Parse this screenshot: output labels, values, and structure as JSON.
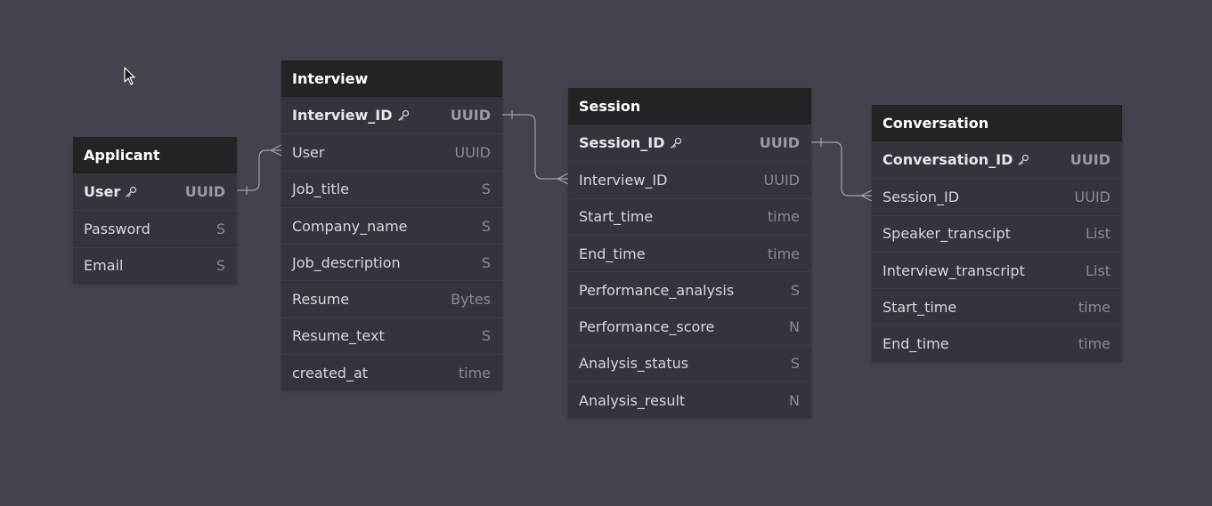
{
  "entities": [
    {
      "title": "Applicant",
      "fields": [
        {
          "name": "User",
          "type": "UUID",
          "pk": true
        },
        {
          "name": "Password",
          "type": "S"
        },
        {
          "name": "Email",
          "type": "S"
        }
      ]
    },
    {
      "title": "Interview",
      "fields": [
        {
          "name": "Interview_ID",
          "type": "UUID",
          "pk": true
        },
        {
          "name": "User",
          "type": "UUID"
        },
        {
          "name": "Job_title",
          "type": "S"
        },
        {
          "name": "Company_name",
          "type": "S"
        },
        {
          "name": "Job_description",
          "type": "S"
        },
        {
          "name": "Resume",
          "type": "Bytes"
        },
        {
          "name": "Resume_text",
          "type": "S"
        },
        {
          "name": "created_at",
          "type": "time"
        }
      ]
    },
    {
      "title": "Session",
      "fields": [
        {
          "name": "Session_ID",
          "type": "UUID",
          "pk": true
        },
        {
          "name": "Interview_ID",
          "type": "UUID"
        },
        {
          "name": "Start_time",
          "type": "time"
        },
        {
          "name": "End_time",
          "type": "time"
        },
        {
          "name": "Performance_analysis",
          "type": "S"
        },
        {
          "name": "Performance_score",
          "type": "N"
        },
        {
          "name": "Analysis_status",
          "type": "S"
        },
        {
          "name": "Analysis_result",
          "type": "N"
        }
      ]
    },
    {
      "title": "Conversation",
      "fields": [
        {
          "name": "Conversation_ID",
          "type": "UUID",
          "pk": true
        },
        {
          "name": "Session_ID",
          "type": "UUID"
        },
        {
          "name": "Speaker_transcipt",
          "type": "List"
        },
        {
          "name": "Interview_transcript",
          "type": "List"
        },
        {
          "name": "Start_time",
          "type": "time"
        },
        {
          "name": "End_time",
          "type": "time"
        }
      ]
    }
  ],
  "relationships": [
    {
      "from": "Applicant.User",
      "to": "Interview.User",
      "cardinality": "one-to-many"
    },
    {
      "from": "Interview.Interview_ID",
      "to": "Session.Interview_ID",
      "cardinality": "one-to-many"
    },
    {
      "from": "Session.Session_ID",
      "to": "Conversation.Session_ID",
      "cardinality": "one-to-many"
    }
  ],
  "icons": {
    "primary_key": "key-icon",
    "pointer": "cursor-icon"
  },
  "colors": {
    "canvas": "#43434d",
    "header": "#232326",
    "body": "#34343c",
    "connector": "#a0a0aa"
  }
}
